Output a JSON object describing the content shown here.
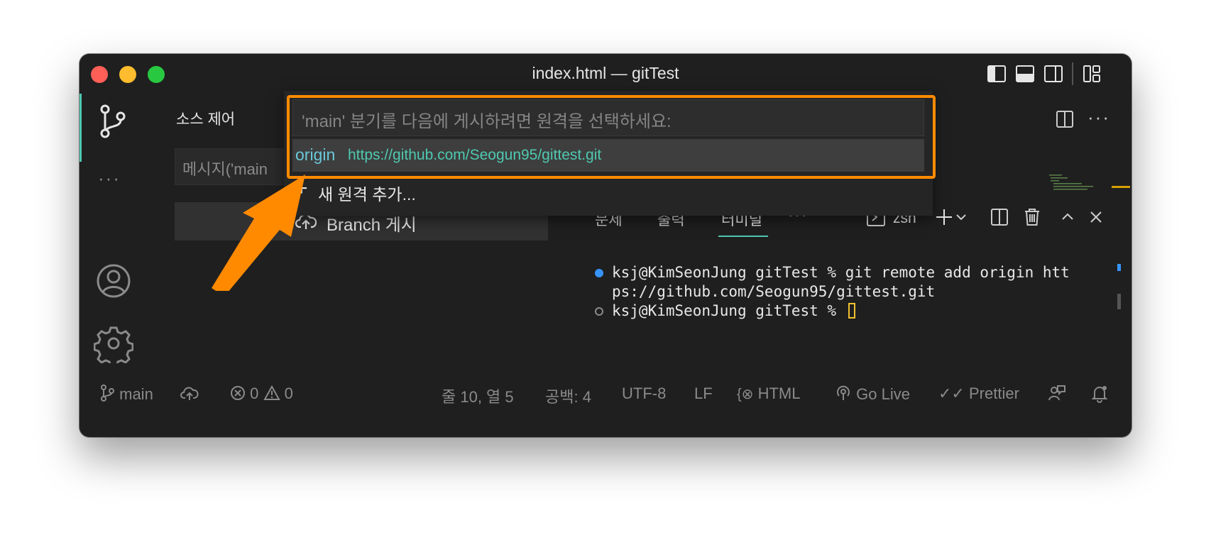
{
  "window": {
    "title": "index.html — gitTest"
  },
  "sidebar": {
    "title": "소스 제어",
    "message_placeholder": "메시지('main",
    "publish_button": "Branch 게시"
  },
  "quickpick": {
    "placeholder": "'main' 분기를 다음에 게시하려면 원격을 선택하세요:",
    "items": [
      {
        "name": "origin",
        "url": "https://github.com/Seogun95/gittest.git"
      },
      {
        "label": "새 원격 추가...",
        "icon": "plus-icon"
      }
    ]
  },
  "panel": {
    "tabs": [
      "문제",
      "출력",
      "터미널"
    ],
    "more": "···",
    "terminal_name": "zsh",
    "lines": [
      "ksj@KimSeonJung gitTest % git remote add origin htt",
      "ps://github.com/Seogun95/gittest.git",
      "ksj@KimSeonJung gitTest % "
    ]
  },
  "activity": {
    "more": "···"
  },
  "status": {
    "branch": "main",
    "errors": "0",
    "warnings": "0",
    "position": "줄 10, 열 5",
    "spaces": "공백: 4",
    "encoding": "UTF-8",
    "eol": "LF",
    "language": "HTML",
    "golive": "Go Live",
    "prettier": "Prettier"
  },
  "colors": {
    "accent": "#4ec9b0",
    "annotation": "#ff8a00",
    "background": "#1f1f1f"
  }
}
